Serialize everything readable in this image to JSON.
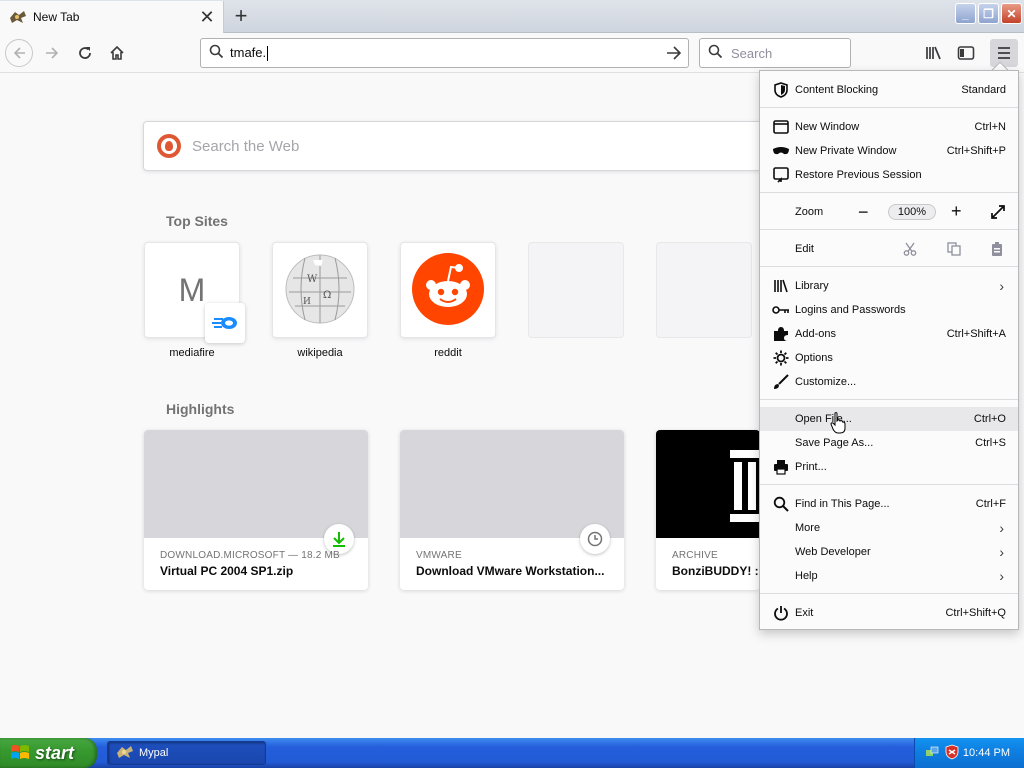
{
  "tab": {
    "title": "New Tab"
  },
  "nav": {
    "url_value": "tmafe.",
    "search_placeholder": "Search"
  },
  "content": {
    "web_search_placeholder": "Search the Web",
    "top_sites_title": "Top Sites",
    "top_sites": [
      {
        "label": "mediafire",
        "letter": "M"
      },
      {
        "label": "wikipedia"
      },
      {
        "label": "reddit"
      },
      {
        "label": ""
      },
      {
        "label": ""
      }
    ],
    "highlights_title": "Highlights",
    "highlights": [
      {
        "source": "DOWNLOAD.MICROSOFT — 18.2 MB",
        "title": "Virtual PC 2004 SP1.zip",
        "icon": "download-icon"
      },
      {
        "source": "VMWARE",
        "title": "Download VMware Workstation...",
        "icon": "clock-icon"
      },
      {
        "source": "ARCHIVE",
        "title": "BonziBUDDY! : J",
        "icon": ""
      }
    ]
  },
  "menu": {
    "content_blocking": {
      "label": "Content Blocking",
      "value": "Standard"
    },
    "new_window": {
      "label": "New Window",
      "shortcut": "Ctrl+N"
    },
    "new_private_window": {
      "label": "New Private Window",
      "shortcut": "Ctrl+Shift+P"
    },
    "restore_session": {
      "label": "Restore Previous Session"
    },
    "zoom": {
      "label": "Zoom",
      "value": "100%",
      "minus": "−",
      "plus": "+"
    },
    "edit": {
      "label": "Edit"
    },
    "library": {
      "label": "Library"
    },
    "logins": {
      "label": "Logins and Passwords"
    },
    "addons": {
      "label": "Add-ons",
      "shortcut": "Ctrl+Shift+A"
    },
    "options": {
      "label": "Options"
    },
    "customize": {
      "label": "Customize..."
    },
    "open_file": {
      "label": "Open File...",
      "shortcut": "Ctrl+O"
    },
    "save_page": {
      "label": "Save Page As...",
      "shortcut": "Ctrl+S"
    },
    "print": {
      "label": "Print..."
    },
    "find": {
      "label": "Find in This Page...",
      "shortcut": "Ctrl+F"
    },
    "more": {
      "label": "More"
    },
    "web_developer": {
      "label": "Web Developer"
    },
    "help": {
      "label": "Help"
    },
    "exit": {
      "label": "Exit",
      "shortcut": "Ctrl+Shift+Q"
    }
  },
  "taskbar": {
    "start_label": "start",
    "task_label": "Mypal",
    "clock": "10:44 PM"
  },
  "colors": {
    "reddit": "#ff4500",
    "duckduckgo": "#de5833",
    "mediafire": "#1a8cff",
    "download_green": "#12bc00"
  }
}
